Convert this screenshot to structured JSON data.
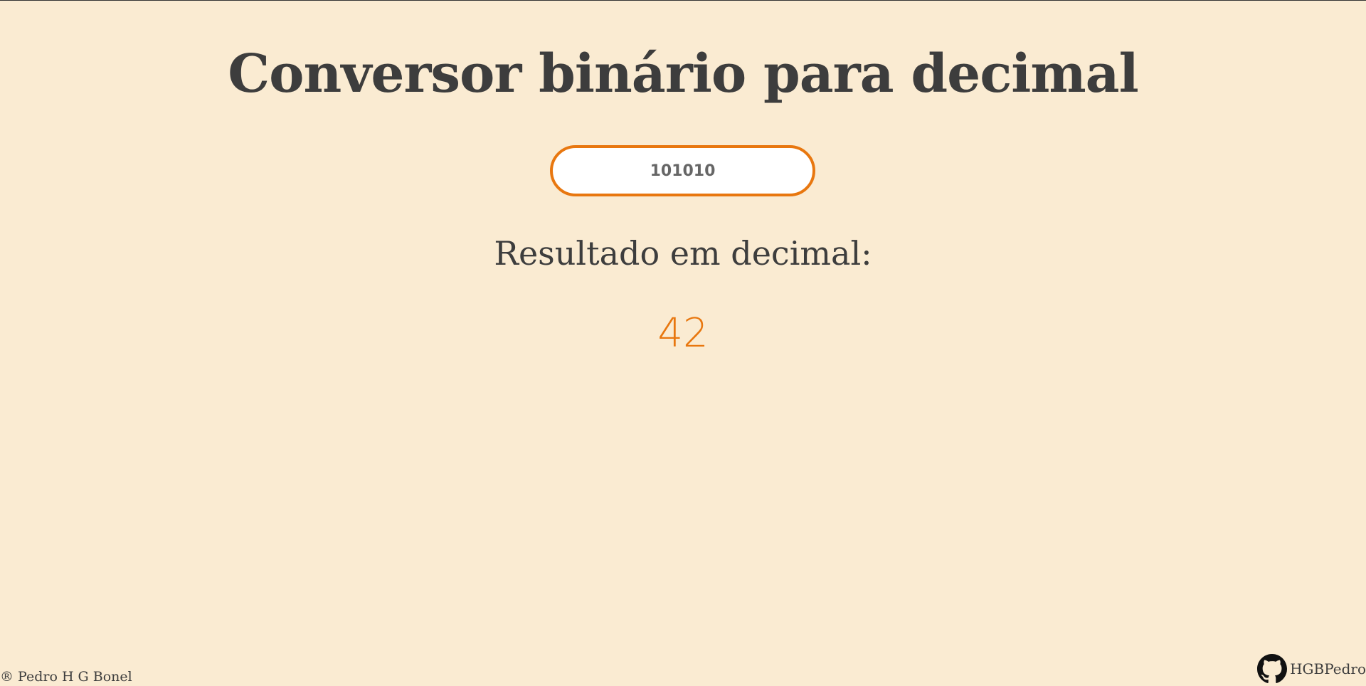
{
  "title": "Conversor binário para decimal",
  "input": {
    "value": "101010",
    "placeholder": ""
  },
  "result": {
    "label": "Resultado em decimal:",
    "value": "42"
  },
  "footer": {
    "copyright": "® Pedro H G Bonel",
    "github_user": "HGBPedro",
    "github_icon": "github-icon"
  },
  "colors": {
    "background": "#faebd2",
    "accent": "#e8770f",
    "text": "#3d3d3d"
  }
}
